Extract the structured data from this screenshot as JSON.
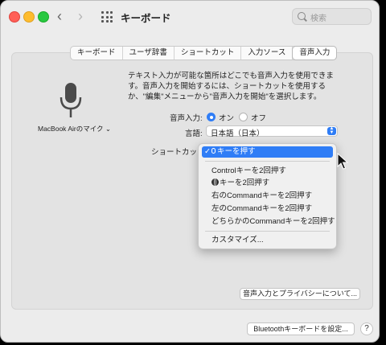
{
  "window": {
    "title": "キーボード"
  },
  "search": {
    "placeholder": "検索"
  },
  "tabs": [
    {
      "label": "キーボード"
    },
    {
      "label": "ユーザ辞書"
    },
    {
      "label": "ショートカット"
    },
    {
      "label": "入力ソース"
    },
    {
      "label": "音声入力"
    }
  ],
  "mic": {
    "source_label": "MacBook Airのマイク ⌄"
  },
  "description": "テキスト入力が可能な箇所はどこでも音声入力を使用できます。音声入力を開始するには、ショートカットを使用するか、\"編集\"メニューから\"音声入力を開始\"を選択します。",
  "dictation": {
    "label": "音声入力:",
    "on_label": "オン",
    "off_label": "オフ"
  },
  "language": {
    "label": "言語:",
    "value": "日本語（日本）"
  },
  "shortcut": {
    "label": "ショートカット"
  },
  "menu": {
    "selected": "キーを押す",
    "items": [
      "Controlキーを2回押す",
      "キーを2回押す",
      "右のCommandキーを2回押す",
      "左のCommandキーを2回押す",
      "どちらかのCommandキーを2回押す"
    ],
    "customize": "カスタマイズ..."
  },
  "buttons": {
    "privacy": "音声入力とプライバシーについて...",
    "bluetooth": "Bluetoothキーボードを設定...",
    "help": "?"
  },
  "colors": {
    "accent": "#2f7df6",
    "close": "#ff5f57",
    "minimize": "#febc2e",
    "maximize": "#28c840"
  }
}
